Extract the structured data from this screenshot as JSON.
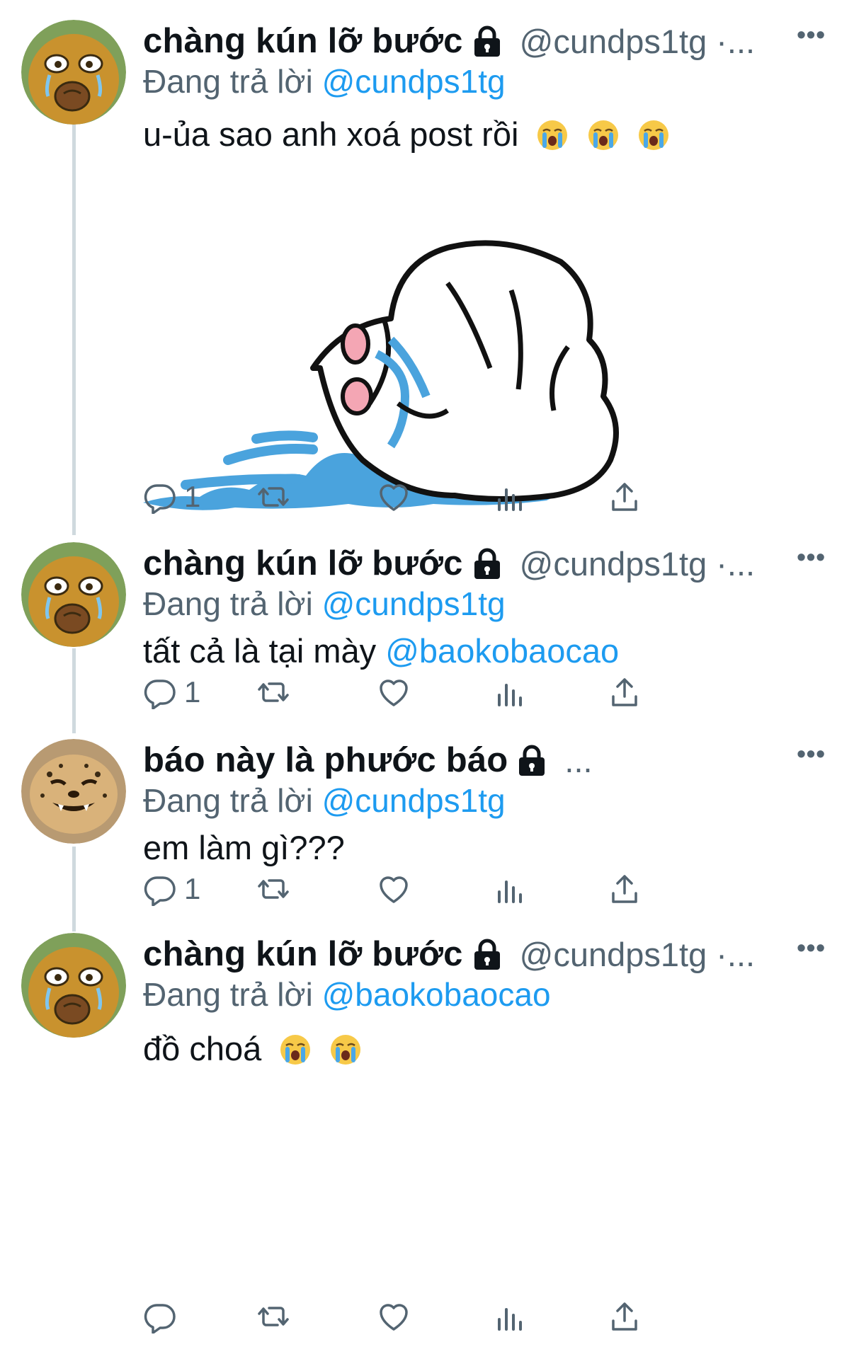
{
  "tweets": [
    {
      "name": "chàng kún lỡ bước",
      "handle": "@cundps1tg ·...",
      "replying_prefix": "Đang trả lời",
      "replying_to": "@cundps1tg",
      "text": "u-ủa sao anh xoá post rồi",
      "emoji": [
        "loudly-crying-face",
        "loudly-crying-face",
        "loudly-crying-face"
      ],
      "reply_count": "1",
      "has_media": true,
      "more_label": "•••"
    },
    {
      "name": "chàng kún lỡ bước",
      "handle": "@cundps1tg ·...",
      "replying_prefix": "Đang trả lời",
      "replying_to": "@cundps1tg",
      "text": "tất cả là tại mày",
      "text_mention": "@baokobaocao",
      "reply_count": "1",
      "more_label": "•••"
    },
    {
      "name": "báo này là phước báo",
      "handle": "...",
      "replying_prefix": "Đang trả lời",
      "replying_to": "@cundps1tg",
      "text": "em làm gì???",
      "reply_count": "1",
      "more_label": "•••"
    },
    {
      "name": "chàng kún lỡ bước",
      "handle": "@cundps1tg ·...",
      "replying_prefix": "Đang trả lời",
      "replying_to": "@baokobaocao",
      "text": "đồ choá",
      "emoji": [
        "loudly-crying-face",
        "loudly-crying-face"
      ],
      "reply_count": "",
      "more_label": "•••"
    }
  ],
  "colors": {
    "accent": "#1d9bf0",
    "muted": "#536471",
    "text": "#0f1419",
    "thread_line": "#cfd9de"
  },
  "icons": [
    "lock-icon",
    "reply-icon",
    "retweet-icon",
    "like-icon",
    "views-icon",
    "share-icon",
    "more-icon"
  ]
}
